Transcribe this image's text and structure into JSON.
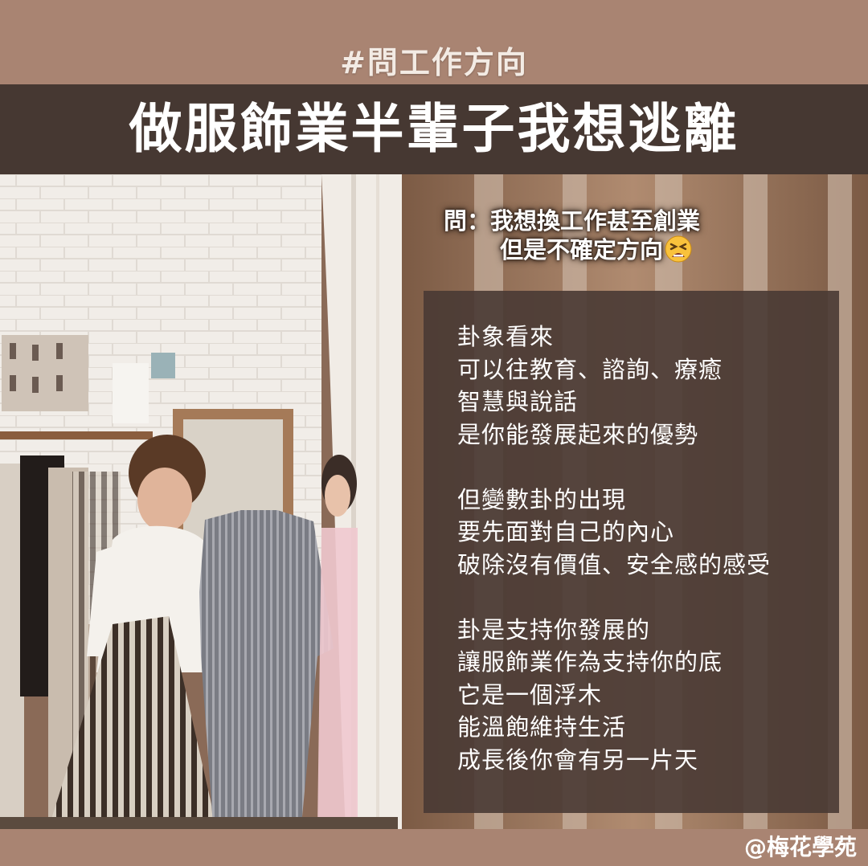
{
  "header": {
    "hashtag": "#問工作方向",
    "title": "做服飾業半輩子我想逃離"
  },
  "photo": {
    "description_icon": "clothing-store-photo"
  },
  "question": {
    "line1": "問：我想換工作甚至創業",
    "line2": "但是不確定方向",
    "emoji_icon": "tired-face-emoji"
  },
  "answer": {
    "paragraph1": [
      "卦象看來",
      "可以往教育、諮詢、療癒",
      "智慧與說話",
      "是你能發展起來的優勢"
    ],
    "paragraph2": [
      "但變數卦的出現",
      "要先面對自己的內心",
      "破除沒有價值、安全感的感受"
    ],
    "paragraph3": [
      "卦是支持你發展的",
      "讓服飾業作為支持你的底",
      "它是一個浮木",
      "能溫飽維持生活",
      "成長後你會有另一片天"
    ]
  },
  "footer": {
    "credit": "@梅花學苑"
  },
  "colors": {
    "band": "#a98472",
    "title_bar": "#463832",
    "text_box": "#493a34"
  }
}
